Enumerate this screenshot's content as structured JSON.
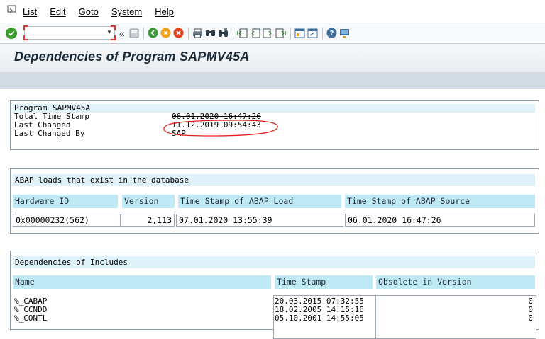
{
  "menu": [
    "List",
    "Edit",
    "Goto",
    "System",
    "Help"
  ],
  "title": "Dependencies of Program SAPMV45A",
  "info": {
    "header_label": "Program",
    "header_value": "SAPMV45A",
    "rows": [
      {
        "label": "Total Time Stamp",
        "value": "06.01.2020 16:47:26"
      },
      {
        "label": "Last Changed",
        "value": "11.12.2019 09:54:43"
      },
      {
        "label": "Last Changed By",
        "value": "SAP"
      }
    ]
  },
  "loads": {
    "heading": "ABAP loads that exist in the database",
    "columns": [
      "Hardware ID",
      "Version",
      "Time Stamp of ABAP Load",
      "Time Stamp of ABAP Source"
    ],
    "row": [
      "0x00000232(562)",
      "2,113",
      "07.01.2020 13:55:39",
      "06.01.2020 16:47:26"
    ]
  },
  "includes": {
    "heading": "Dependencies of Includes",
    "columns": [
      "Name",
      "Time Stamp",
      "Obsolete in Version"
    ],
    "rows": [
      {
        "name": "%_CABAP",
        "ts": "20.03.2015 07:32:55",
        "obs": "0"
      },
      {
        "name": "%_CCNDD",
        "ts": "18.02.2005 14:15:16",
        "obs": "0"
      },
      {
        "name": "%_CONTL",
        "ts": "05.10.2001 14:55:05",
        "obs": "0"
      }
    ]
  },
  "colors": {
    "highlight": "#dff1f9",
    "header": "#bfe9f5",
    "annotation": "#e0201c"
  }
}
